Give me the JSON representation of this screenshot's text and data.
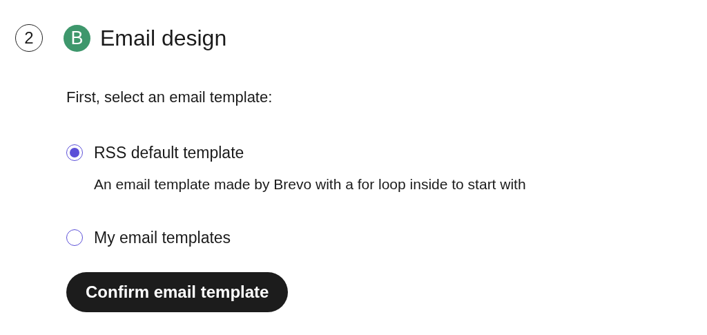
{
  "step": {
    "number": "2",
    "logo_letter": "B",
    "title": "Email design"
  },
  "prompt": "First, select an email template:",
  "options": [
    {
      "label": "RSS default template",
      "description": "An email template made by Brevo with a for loop inside to start with",
      "selected": true
    },
    {
      "label": "My email templates",
      "selected": false
    }
  ],
  "button": "Confirm email template"
}
